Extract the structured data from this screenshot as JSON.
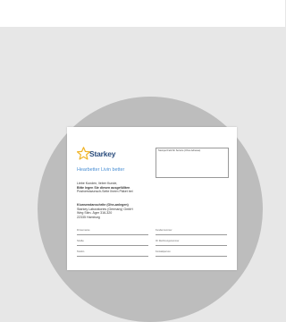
{
  "brand": {
    "name": "Starkey",
    "star_color": "#f0b428",
    "text_color": "#2c4e7e"
  },
  "form": {
    "title": "Hearbetter Livin better",
    "stamp_label": "Stempel Feld für Service (Ohne Adresse)",
    "greeting_lines": [
      {
        "text": "Liebe Kunden, lieber Kunde,",
        "bold": false
      },
      {
        "text": "Bitte legen Sie diesen ausgefüllten",
        "bold": true
      },
      {
        "text": "Postversiwunsch-Seite Ihrem Päket bei",
        "bold": false
      }
    ],
    "address_lines": [
      {
        "text": "Kiunsendanschrite (Ohn-anlegen)",
        "bold": true
      },
      {
        "text": "Starkey Laboratories (Germany) GmbH",
        "bold": false
      },
      {
        "text": "Weg Stim. Äger 316-320",
        "bold": false
      },
      {
        "text": "22335 Hamburg",
        "bold": false
      }
    ],
    "fields": [
      {
        "label": "Firmenname"
      },
      {
        "label": "Kundennummer"
      },
      {
        "label": "Straße"
      },
      {
        "label": "Ihr Rechnungsnummer"
      },
      {
        "label": "Telefon"
      },
      {
        "label": "Kontaktperson"
      }
    ]
  }
}
